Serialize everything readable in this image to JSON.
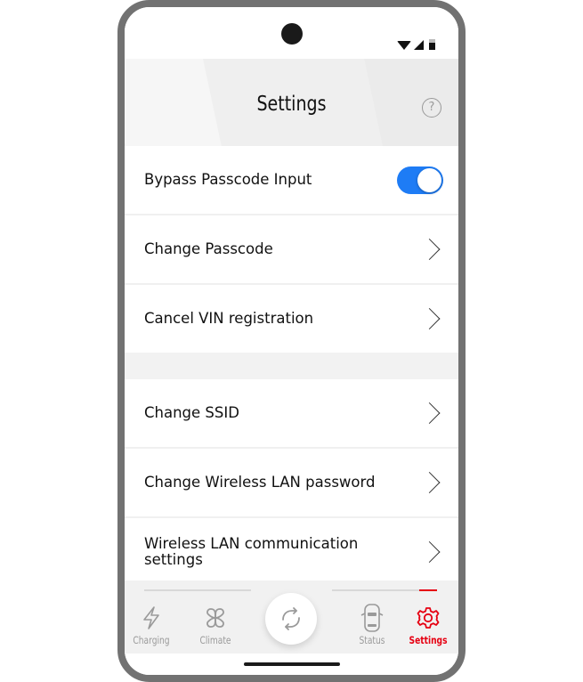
{
  "header": {
    "title": "Settings",
    "help_icon": "question-circle-icon"
  },
  "status_bar": {
    "icons": [
      "wifi-icon",
      "signal-icon",
      "battery-icon"
    ]
  },
  "settings": {
    "group1": [
      {
        "label": "Bypass Passcode Input",
        "type": "toggle",
        "value": true
      },
      {
        "label": "Change Passcode",
        "type": "link"
      },
      {
        "label": "Cancel VIN registration",
        "type": "link"
      }
    ],
    "group2": [
      {
        "label": "Change SSID",
        "type": "link"
      },
      {
        "label": "Change Wireless LAN password",
        "type": "link"
      },
      {
        "label": "Wireless LAN communication settings",
        "type": "link"
      }
    ]
  },
  "tabbar": {
    "tabs": [
      {
        "label": "Charging",
        "icon": "lightning-icon"
      },
      {
        "label": "Climate",
        "icon": "fan-icon"
      },
      {
        "label": "Status",
        "icon": "car-icon"
      },
      {
        "label": "Settings",
        "icon": "gear-icon",
        "active": true
      }
    ],
    "center_icon": "refresh-icon"
  },
  "colors": {
    "accent_red": "#e60012",
    "toggle_blue": "#1e7cf5"
  }
}
